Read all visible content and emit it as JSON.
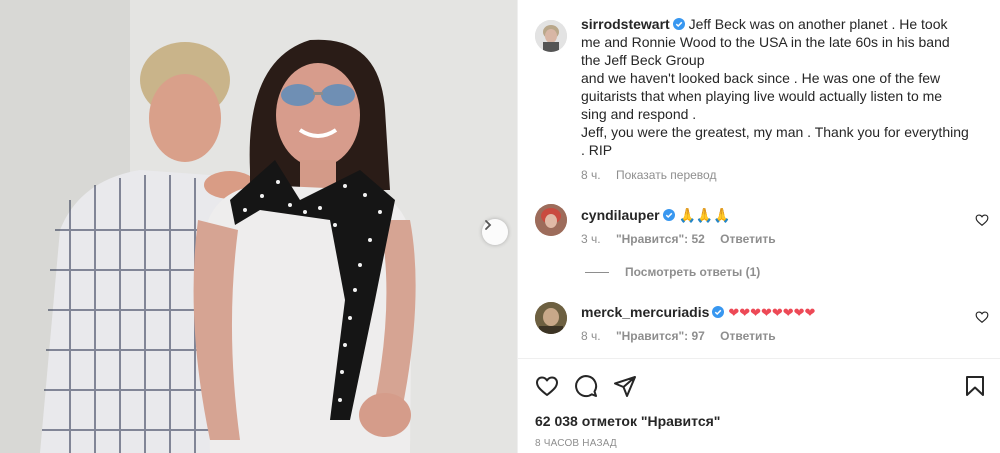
{
  "post": {
    "author": "sirrodstewart",
    "caption_lines": [
      "Jeff Beck was on another planet . He took",
      "me and Ronnie Wood to the USA in the late 60s in his band",
      "the Jeff Beck Group",
      "and we haven't looked back since . He was one of the few",
      "guitarists that when playing live would actually listen to me",
      "sing and respond .",
      "Jeff, you were the greatest, my man . Thank you for everything",
      ". RIP"
    ],
    "caption_age": "8 ч.",
    "translate_label": "Показать перевод",
    "likes_text": "62 038 отметок \"Нравится\"",
    "posted_ago": "8 ЧАСОВ НАЗАД"
  },
  "comments": [
    {
      "username": "cyndilauper",
      "text": "🙏🙏🙏",
      "age": "3 ч.",
      "likes": "\"Нравится\": 52",
      "reply_label": "Ответить",
      "view_replies": "Посмотреть ответы (1)"
    },
    {
      "username": "merck_mercuriadis",
      "text": "❤❤❤❤❤❤❤❤",
      "age": "8 ч.",
      "likes": "\"Нравится\": 97",
      "reply_label": "Ответить"
    }
  ],
  "icons": {
    "verified": "verified-badge-icon",
    "like": "heart-icon",
    "comment": "comment-icon",
    "share": "send-icon",
    "save": "bookmark-icon",
    "next": "chevron-right-icon"
  },
  "colors": {
    "verified": "#3897f0",
    "heart_red": "#ed4956",
    "text": "#262626",
    "muted": "#8e8e8e"
  }
}
